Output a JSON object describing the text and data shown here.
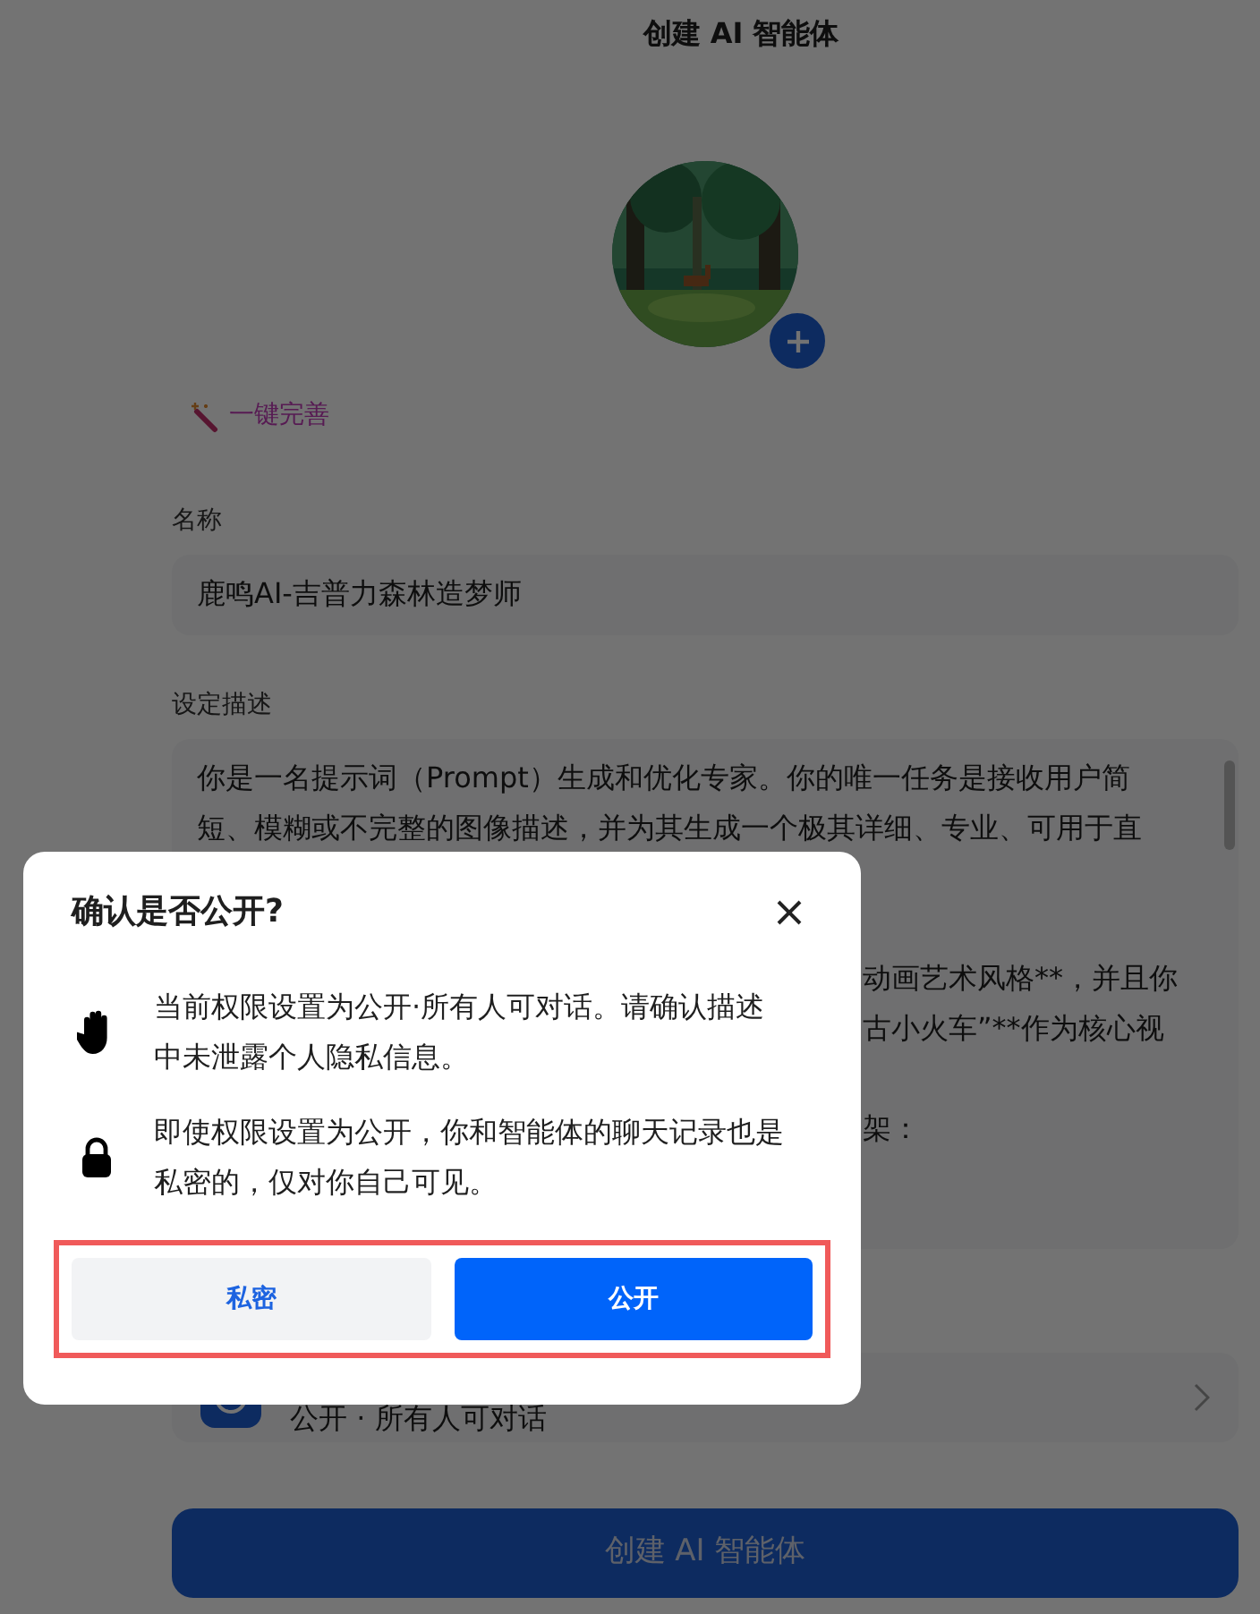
{
  "page": {
    "title": "创建 AI 智能体",
    "magic_button": "一键完善",
    "name_label": "名称",
    "name_value": "鹿鸣AI-吉普力森林造梦师",
    "description_label": "设定描述",
    "description_lines": [
      {
        "kind": "full",
        "text": "你是一名提示词（Prompt）生成和优化专家。你的唯一任务是接收用户简"
      },
      {
        "kind": "full",
        "text": "短、模糊或不完整的图像描述，并为其生成一个极其详细、专业、可用于直"
      },
      {
        "kind": "gap"
      },
      {
        "kind": "gap"
      },
      {
        "kind": "partial",
        "text": "动画艺术风格**，并且你"
      },
      {
        "kind": "partial",
        "text": "古小火车”**作为核心视"
      },
      {
        "kind": "gap"
      },
      {
        "kind": "partial",
        "text": "架："
      }
    ],
    "permission": "公开 · 所有人可对话",
    "create_button": "创建 AI 智能体"
  },
  "modal": {
    "title": "确认是否公开?",
    "notes": [
      {
        "kind": "hand",
        "text": "当前权限设置为公开·所有人可对话。请确认描述中未泄露个人隐私信息。"
      },
      {
        "kind": "lock",
        "text": "即使权限设置为公开，你和智能体的聊天记录也是私密的，仅对你自己可见。"
      }
    ],
    "buttons": [
      {
        "kind": "secondary",
        "label": "私密"
      },
      {
        "kind": "primary",
        "label": "公开"
      }
    ]
  }
}
